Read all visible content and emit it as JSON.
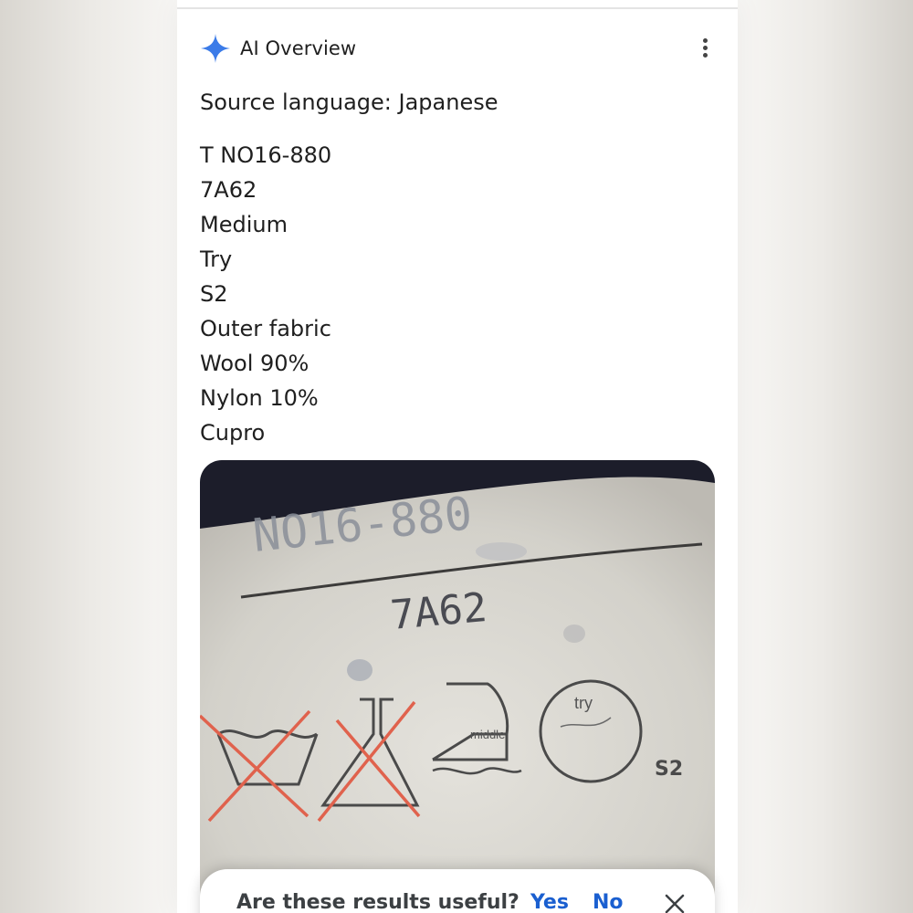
{
  "overview": {
    "title": "AI Overview",
    "icons": {
      "sparkle": "gemini-sparkle-icon",
      "menu": "more-vert-icon"
    },
    "accent_color": "#3b7be8"
  },
  "source_language": "Source language: Japanese",
  "translation_lines": [
    "T NO16-880",
    "7A62",
    "Medium",
    "Try",
    "S2",
    "Outer fabric",
    "Wool 90%",
    "Nylon 10%",
    "Cupro"
  ],
  "image": {
    "label_text_top": "NO16-880",
    "label_text_code": "7A62",
    "iron_overlay": "middle",
    "circle_overlay": "try",
    "size_mark": "S2",
    "cross_color": "#e0624d"
  },
  "feedback": {
    "question": "Are these results useful?",
    "yes": "Yes",
    "no": "No",
    "close_icon": "close-icon",
    "link_color": "#1a5fd0"
  }
}
